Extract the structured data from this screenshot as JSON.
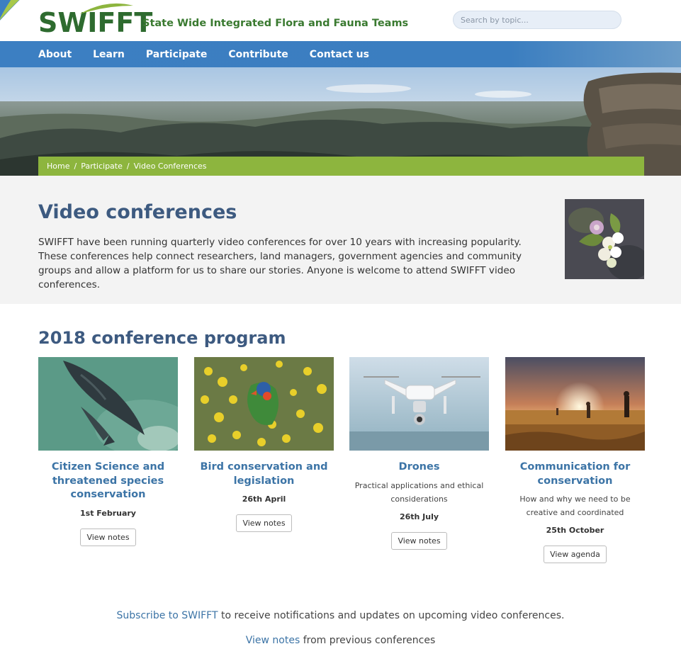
{
  "header": {
    "logo": "SWIFFT",
    "tagline": "State Wide Integrated Flora and Fauna Teams",
    "search_placeholder": "Search by topic..."
  },
  "nav": {
    "items": [
      {
        "label": "About"
      },
      {
        "label": "Learn"
      },
      {
        "label": "Participate"
      },
      {
        "label": "Contribute"
      },
      {
        "label": "Contact us"
      }
    ]
  },
  "breadcrumb": {
    "items": [
      {
        "label": "Home"
      },
      {
        "label": "Participate"
      },
      {
        "label": "Video Conferences"
      }
    ],
    "separator": "/"
  },
  "intro": {
    "title": "Video conferences",
    "text": "SWIFFT have been running quarterly video conferences for over 10 years with increasing popularity. These conferences help connect researchers, land managers, government agencies and community groups and allow a platform for us to share our stories. Anyone is welcome to attend SWIFFT video conferences."
  },
  "program": {
    "title": "2018 conference program",
    "cards": [
      {
        "title": "Citizen Science and threatened species conservation",
        "desc": "",
        "date": "1st February",
        "button": "View notes"
      },
      {
        "title": "Bird conservation and legislation",
        "desc": "",
        "date": "26th April",
        "button": "View notes"
      },
      {
        "title": "Drones",
        "desc": "Practical applications and ethical considerations",
        "date": "26th July",
        "button": "View notes"
      },
      {
        "title": "Communication for conservation",
        "desc": "How and why we need to be creative and coordinated",
        "date": "25th October",
        "button": "View agenda"
      }
    ]
  },
  "footer": {
    "subscribe_link": "Subscribe to SWIFFT",
    "subscribe_text": " to receive notifications and updates on upcoming video conferences.",
    "notes_link": "View notes",
    "notes_text": " from previous conferences"
  },
  "colors": {
    "nav": "#3c7fc2",
    "breadcrumb": "#8db53e",
    "heading": "#3d5a80",
    "link": "#3c74a6",
    "logo": "#2e6b2f"
  }
}
